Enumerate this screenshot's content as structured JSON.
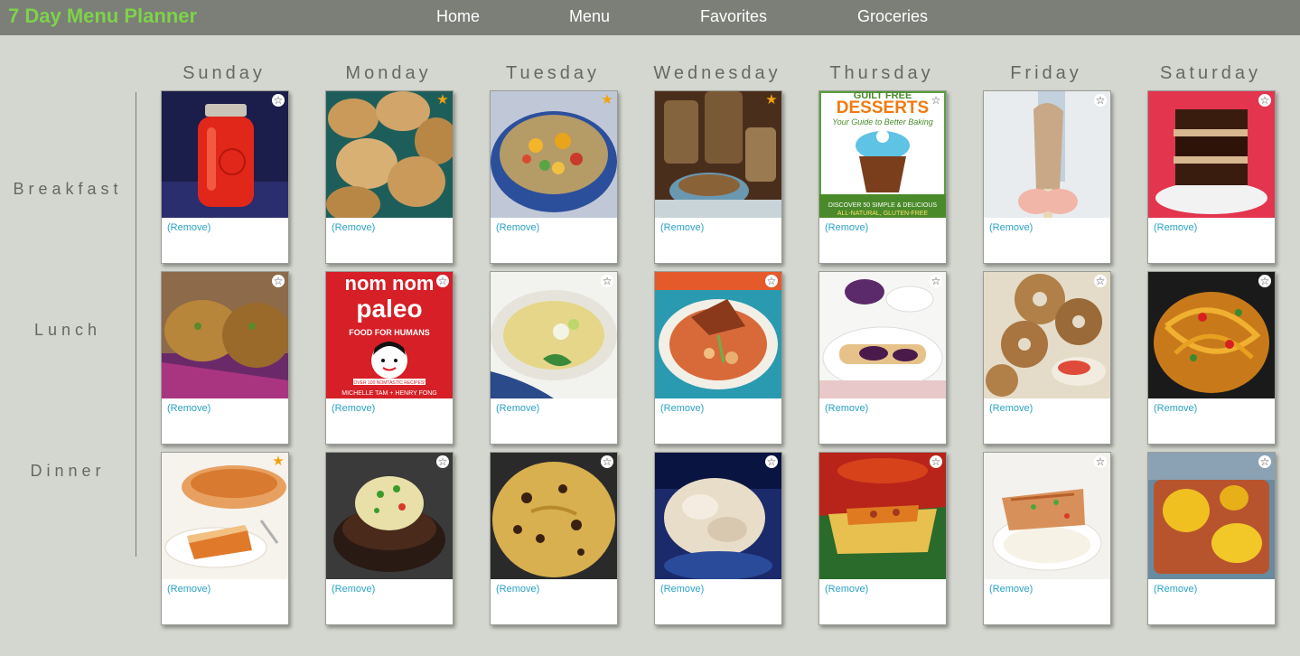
{
  "app": {
    "title": "7 Day Menu Planner",
    "brand_color": "#7dd34a"
  },
  "nav": {
    "items": [
      "Home",
      "Menu",
      "Favorites",
      "Groceries"
    ]
  },
  "days": [
    "Sunday",
    "Monday",
    "Tuesday",
    "Wednesday",
    "Thursday",
    "Friday",
    "Saturday"
  ],
  "meals": [
    "Breakfast",
    "Lunch",
    "Dinner"
  ],
  "remove_label": "(Remove)",
  "book_covers": {
    "desserts": {
      "line1": "GUILT FREE",
      "line2": "DESSERTS",
      "subtitle": "Your Guide to Better Baking",
      "footer1": "DISCOVER 50 SIMPLE & DELICIOUS",
      "footer2": "ALL-NATURAL, GLUTEN-FREE"
    },
    "paleo": {
      "line1": "nom nom",
      "line2": "paleo",
      "tagline": "FOOD FOR HUMANS",
      "badge": "OVER 100 NOMTASTIC RECIPES!",
      "authors": "MICHELLE TAM + HENRY FONG"
    }
  },
  "grid": [
    [
      {
        "day": "Sunday",
        "meal": "Breakfast",
        "favorite": false,
        "image": "jar-sauce"
      },
      {
        "day": "Monday",
        "meal": "Breakfast",
        "favorite": true,
        "image": "biscuits"
      },
      {
        "day": "Tuesday",
        "meal": "Breakfast",
        "favorite": true,
        "image": "salad-bowl"
      },
      {
        "day": "Wednesday",
        "meal": "Breakfast",
        "favorite": true,
        "image": "granola-jars"
      },
      {
        "day": "Thursday",
        "meal": "Breakfast",
        "favorite": false,
        "image": "book-desserts"
      },
      {
        "day": "Friday",
        "meal": "Breakfast",
        "favorite": false,
        "image": "popsicle"
      },
      {
        "day": "Saturday",
        "meal": "Breakfast",
        "favorite": false,
        "image": "brownies"
      }
    ],
    [
      {
        "day": "Sunday",
        "meal": "Lunch",
        "favorite": false,
        "image": "crab-cakes"
      },
      {
        "day": "Monday",
        "meal": "Lunch",
        "favorite": false,
        "image": "book-paleo"
      },
      {
        "day": "Tuesday",
        "meal": "Lunch",
        "favorite": false,
        "image": "soup-bowl"
      },
      {
        "day": "Wednesday",
        "meal": "Lunch",
        "favorite": false,
        "image": "stew"
      },
      {
        "day": "Thursday",
        "meal": "Lunch",
        "favorite": false,
        "image": "crepes"
      },
      {
        "day": "Friday",
        "meal": "Lunch",
        "favorite": false,
        "image": "bagels"
      },
      {
        "day": "Saturday",
        "meal": "Lunch",
        "favorite": false,
        "image": "noodles"
      }
    ],
    [
      {
        "day": "Sunday",
        "meal": "Dinner",
        "favorite": true,
        "image": "pumpkin-pie"
      },
      {
        "day": "Monday",
        "meal": "Dinner",
        "favorite": false,
        "image": "stuffed-mushroom"
      },
      {
        "day": "Tuesday",
        "meal": "Dinner",
        "favorite": false,
        "image": "cookie-skillet"
      },
      {
        "day": "Wednesday",
        "meal": "Dinner",
        "favorite": false,
        "image": "fluffy-dish"
      },
      {
        "day": "Thursday",
        "meal": "Dinner",
        "favorite": false,
        "image": "tamale"
      },
      {
        "day": "Friday",
        "meal": "Dinner",
        "favorite": false,
        "image": "fish-rice"
      },
      {
        "day": "Saturday",
        "meal": "Dinner",
        "favorite": false,
        "image": "poached-pears"
      }
    ]
  ],
  "colors": {
    "background": "#d4d7cf",
    "topbar": "#7c7e78",
    "link": "#2aa3c7",
    "favorite_star": "#f2a20c"
  }
}
